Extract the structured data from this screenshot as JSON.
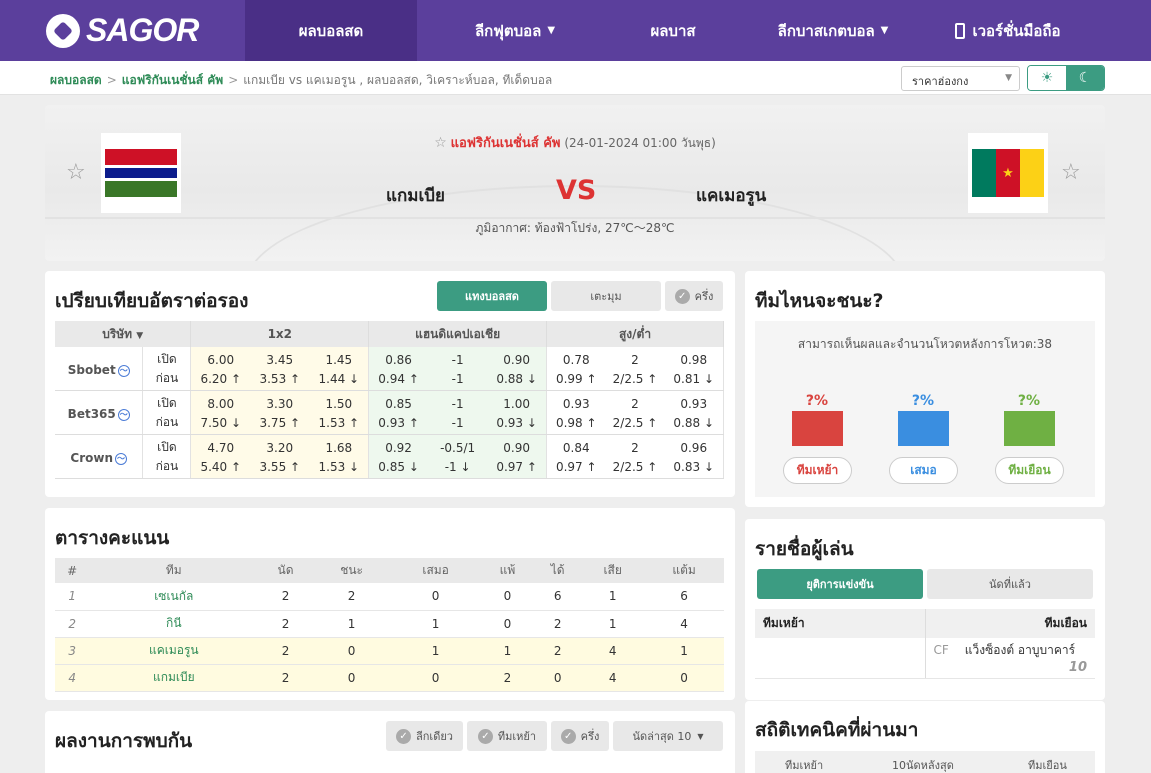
{
  "nav": {
    "logo": "SAGOR",
    "items": [
      {
        "label": "ผลบอลสด",
        "dropdown": false
      },
      {
        "label": "ลีกฟุตบอล",
        "dropdown": true
      },
      {
        "label": "ผลบาส",
        "dropdown": false
      },
      {
        "label": "ลีกบาสเกตบอล",
        "dropdown": true
      },
      {
        "label": "เวอร์ชั่นมือถือ",
        "dropdown": false
      }
    ]
  },
  "breadcrumb": {
    "home": "ผลบอลสด",
    "league": "แอฟริกันเนชั่นส์ คัพ",
    "current": "แกมเบีย vs  แคเมอรูน ,  ผลบอลสด,  วิเคราะห์บอล,  ทีเด็ดบอล"
  },
  "odds_select": "ราคาฮ่องกง",
  "theme_icons": {
    "light": "sun-icon",
    "dark": "moon-icon"
  },
  "match": {
    "league": "แอฟริกันเนชั่นส์ คัพ",
    "datetime": "(24-01-2024 01:00 วันพุธ)",
    "home": "แกมเบีย",
    "away": "แคเมอรูน",
    "vs": "VS",
    "weather": "ภูมิอากาศ: ท้องฟ้าโปร่ง, 27℃～28℃",
    "home_flag_colors": [
      "#ce1126",
      "#0c1c8c",
      "#3a7728"
    ],
    "away_flag_colors": [
      "#007a5e",
      "#ce1126",
      "#fcd116"
    ]
  },
  "odds": {
    "title": "เปรียบเทียบอัตราต่อรอง",
    "tabs": [
      "แทงบอลสด",
      "เตะมุม",
      "ครึ่ง"
    ],
    "headers": {
      "company": "บริษัท",
      "x12": "1x2",
      "ah": "แฮนดิแคปเอเชีย",
      "ou": "สูง/ต่ำ"
    },
    "rows": [
      {
        "book": "Sbobet",
        "open": {
          "label": "เปิด",
          "x12": [
            "6.00",
            "3.45",
            "1.45"
          ],
          "ah": [
            "0.86",
            "-1",
            "0.90"
          ],
          "ou": [
            "0.78",
            "2",
            "0.98"
          ]
        },
        "pre": {
          "label": "ก่อน",
          "x12": [
            "6.20 ↑",
            "3.53 ↑",
            "1.44 ↓"
          ],
          "ah": [
            "0.94 ↑",
            "-1",
            "0.88 ↓"
          ],
          "ou": [
            "0.99 ↑",
            "2/2.5 ↑",
            "0.81 ↓"
          ]
        }
      },
      {
        "book": "Bet365",
        "open": {
          "label": "เปิด",
          "x12": [
            "8.00",
            "3.30",
            "1.50"
          ],
          "ah": [
            "0.85",
            "-1",
            "1.00"
          ],
          "ou": [
            "0.93",
            "2",
            "0.93"
          ]
        },
        "pre": {
          "label": "ก่อน",
          "x12": [
            "7.50 ↓",
            "3.75 ↑",
            "1.53 ↑"
          ],
          "ah": [
            "0.93 ↑",
            "-1",
            "0.93 ↓"
          ],
          "ou": [
            "0.98 ↑",
            "2/2.5 ↑",
            "0.88 ↓"
          ]
        }
      },
      {
        "book": "Crown",
        "open": {
          "label": "เปิด",
          "x12": [
            "4.70",
            "3.20",
            "1.68"
          ],
          "ah": [
            "0.92",
            "-0.5/1",
            "0.90"
          ],
          "ou": [
            "0.84",
            "2",
            "0.96"
          ]
        },
        "pre": {
          "label": "ก่อน",
          "x12": [
            "5.40 ↑",
            "3.55 ↑",
            "1.53 ↓"
          ],
          "ah": [
            "0.85 ↓",
            "-1 ↓",
            "0.97 ↑"
          ],
          "ou": [
            "0.97 ↑",
            "2/2.5 ↑",
            "0.83 ↓"
          ]
        }
      }
    ]
  },
  "standings": {
    "title": "ตารางคะแนน",
    "headers": [
      "#",
      "ทีม",
      "นัด",
      "ชนะ",
      "เสมอ",
      "แพ้",
      "ได้",
      "เสีย",
      "แต้ม"
    ],
    "rows": [
      [
        "1",
        "เซเนกัล",
        "2",
        "2",
        "0",
        "0",
        "6",
        "1",
        "6"
      ],
      [
        "2",
        "กินี",
        "2",
        "1",
        "1",
        "0",
        "2",
        "1",
        "4"
      ],
      [
        "3",
        "แคเมอรูน",
        "2",
        "0",
        "1",
        "1",
        "2",
        "4",
        "1"
      ],
      [
        "4",
        "แกมเบีย",
        "2",
        "0",
        "0",
        "2",
        "0",
        "4",
        "0"
      ]
    ]
  },
  "prediction": {
    "title": "ทีมไหนจะชนะ?",
    "note": "สามารถเห็นผลและจำนวนโหวตหลังการโหวต:38",
    "options": [
      {
        "pct": "?%",
        "label": "ทีมเหย้า",
        "color": "#d9443f"
      },
      {
        "pct": "?%",
        "label": "เสมอ",
        "color": "#3a8ee0"
      },
      {
        "pct": "?%",
        "label": "ทีมเยือน",
        "color": "#6fb043"
      }
    ]
  },
  "players": {
    "title": "รายชื่อผู้เล่น",
    "tabs": [
      "ยุติการแข่งขัน",
      "นัดที่แล้ว"
    ],
    "home_header": "ทีมเหย้า",
    "away_header": "ทีมเยือน",
    "away_player": {
      "pos": "CF",
      "name": "แว็งซ็องต์ อาบูบาคาร์",
      "number": "10"
    }
  },
  "h2h": {
    "title": "ผลงานการพบกัน",
    "filters": [
      "ลีกเดียว",
      "ทีมเหย้า",
      "ครึ่ง"
    ],
    "recent_select": "นัดล่าสุด 10"
  },
  "tech": {
    "title": "สถิติเทคนิคที่ผ่านมา",
    "headers": [
      "ทีมเหย้า",
      "10นัดหลังสุด",
      "ทีมเยือน"
    ]
  }
}
